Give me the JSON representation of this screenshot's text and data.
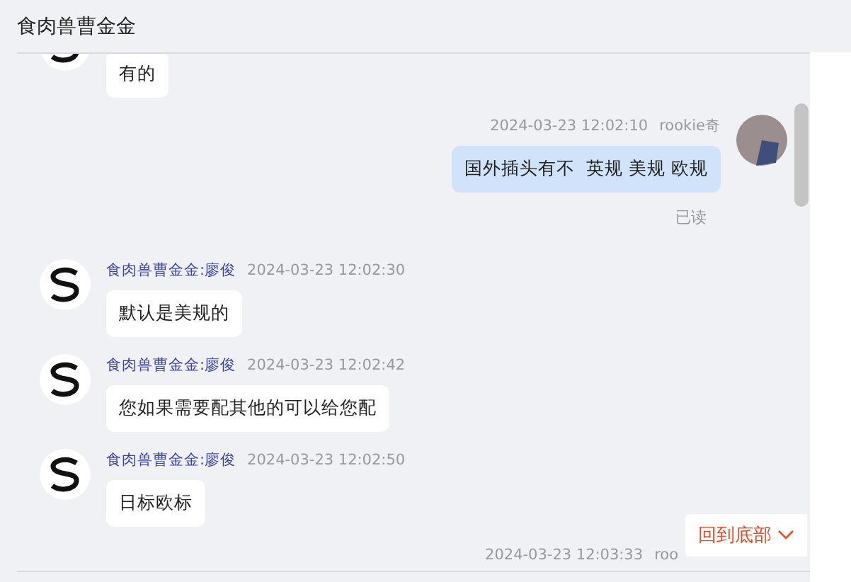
{
  "header": {
    "title": "食肉兽曹金金"
  },
  "messages": [
    {
      "kind": "received",
      "text": "有的"
    },
    {
      "kind": "sent",
      "time": "2024-03-23 12:02:10",
      "sender": "rookie奇",
      "text": "国外插头有不  英规 美规 欧规",
      "status": "已读"
    },
    {
      "kind": "received",
      "sender": "食肉兽曹金金:廖俊",
      "time": "2024-03-23 12:02:30",
      "text": "默认是美规的"
    },
    {
      "kind": "received",
      "sender": "食肉兽曹金金:廖俊",
      "time": "2024-03-23 12:02:42",
      "text": "您如果需要配其他的可以给您配"
    },
    {
      "kind": "received",
      "sender": "食肉兽曹金金:廖俊",
      "time": "2024-03-23 12:02:50",
      "text": "日标欧标"
    },
    {
      "kind": "sent",
      "time": "2024-03-23 12:03:33",
      "sender": "roo"
    }
  ],
  "scroll_bottom_button": {
    "label": "回到底部"
  }
}
